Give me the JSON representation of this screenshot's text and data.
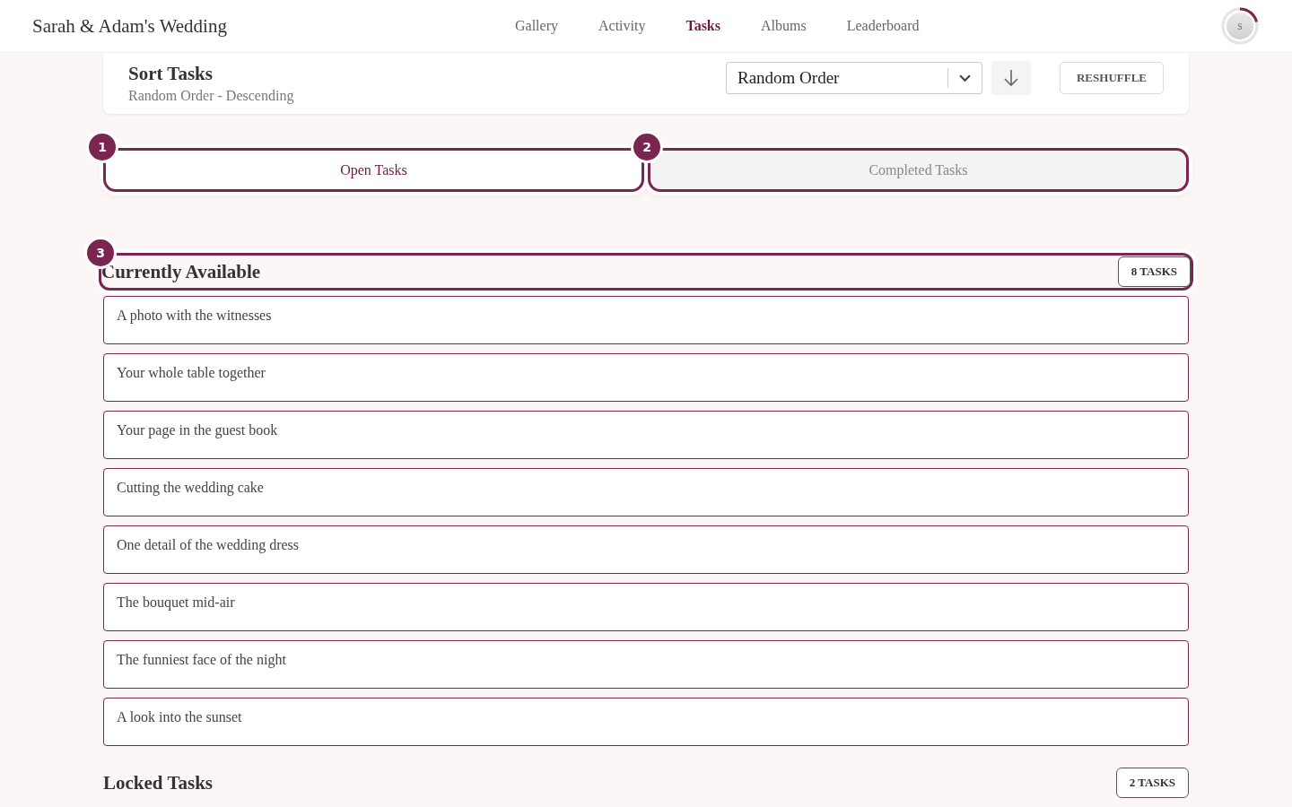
{
  "header": {
    "title": "Sarah & Adam's Wedding",
    "nav": [
      {
        "label": "Gallery",
        "selected": false
      },
      {
        "label": "Activity",
        "selected": false
      },
      {
        "label": "Tasks",
        "selected": true
      },
      {
        "label": "Albums",
        "selected": false
      },
      {
        "label": "Leaderboard",
        "selected": false
      }
    ],
    "avatar": {
      "initial": "S"
    }
  },
  "sort": {
    "title": "Sort Tasks",
    "subtitle": "Random Order - Descending",
    "select": {
      "value": "Random Order"
    },
    "button": "RESHUFFLE"
  },
  "tabs": [
    {
      "label": "Open Tasks",
      "step": "1",
      "selected": true
    },
    {
      "label": "Completed Tasks",
      "step": "2",
      "selected": false
    }
  ],
  "sections": [
    {
      "title": "Currently Available",
      "count": "8 TASKS",
      "step": "3",
      "highlighted": true,
      "tasks": [
        "A photo with the witnesses",
        "Your whole table together",
        "Your page in the guest book",
        "Cutting the wedding cake",
        "One detail of the wedding dress",
        "The bouquet mid-air",
        "The funniest face of the night",
        "A look into the sunset"
      ]
    },
    {
      "title": "Locked Tasks",
      "count": "2 TASKS",
      "highlighted": false
    }
  ]
}
